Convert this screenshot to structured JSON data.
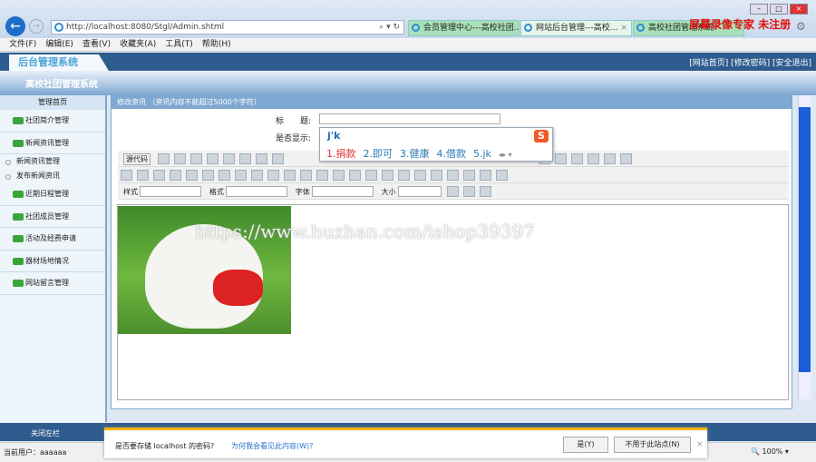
{
  "browser": {
    "url": "http://localhost:8080/Stgl/Admin.shtml",
    "tabs": [
      "会员管理中心---高校社团...",
      "网站后台管理---高校...",
      "高校社团管理系统"
    ],
    "tab_close": "×",
    "recorder_overlay": "屏幕录像专家 未注册"
  },
  "menu": [
    "文件(F)",
    "编辑(E)",
    "查看(V)",
    "收藏夹(A)",
    "工具(T)",
    "帮助(H)"
  ],
  "header": {
    "logo": "后台管理系统",
    "system_title": "高校社团管理系统",
    "links": "[网站首页] [修改密码] [安全退出]"
  },
  "sidebar": {
    "home": "管理首页",
    "items": [
      "社团简介管理",
      "新闻资讯管理"
    ],
    "subitems": [
      "新闻资讯管理",
      "发布新闻资讯"
    ],
    "items2": [
      "近期日程管理",
      "社团成员管理",
      "活动及经费申请",
      "器材场地情况",
      "网站留言管理"
    ]
  },
  "main": {
    "heading": "修改资讯 （资讯内容不能超过5000个字符）",
    "title_label": "标　　题:",
    "title_value": "",
    "show_label": "是否显示:",
    "source_button": "源代码",
    "style_label": "样式",
    "format_label": "格式",
    "font_label": "字体",
    "size_label": "大小",
    "watermark": "https://www.huzhan.com/ishop39397"
  },
  "ime": {
    "composition": "j'k",
    "candidates": [
      "1.捐款",
      "2.即可",
      "3.健康",
      "4.借款",
      "5.jk"
    ],
    "logo": "S"
  },
  "footer": {
    "toggle": "关闭左栏"
  },
  "status": {
    "user": "当前用户：aaaaaa",
    "zoom": "100%"
  },
  "notification": {
    "question": "是否要存储 localhost 的密码?",
    "link": "为何我会看见此内容(W)?",
    "yes": "是(Y)",
    "never": "不用于此站点(N)",
    "close": "×"
  },
  "colors": {
    "banner": "#2f5c8e",
    "accent": "#7ea7d1",
    "recorder": "#e01010",
    "scroll_thumb": "#1a5fd8"
  }
}
